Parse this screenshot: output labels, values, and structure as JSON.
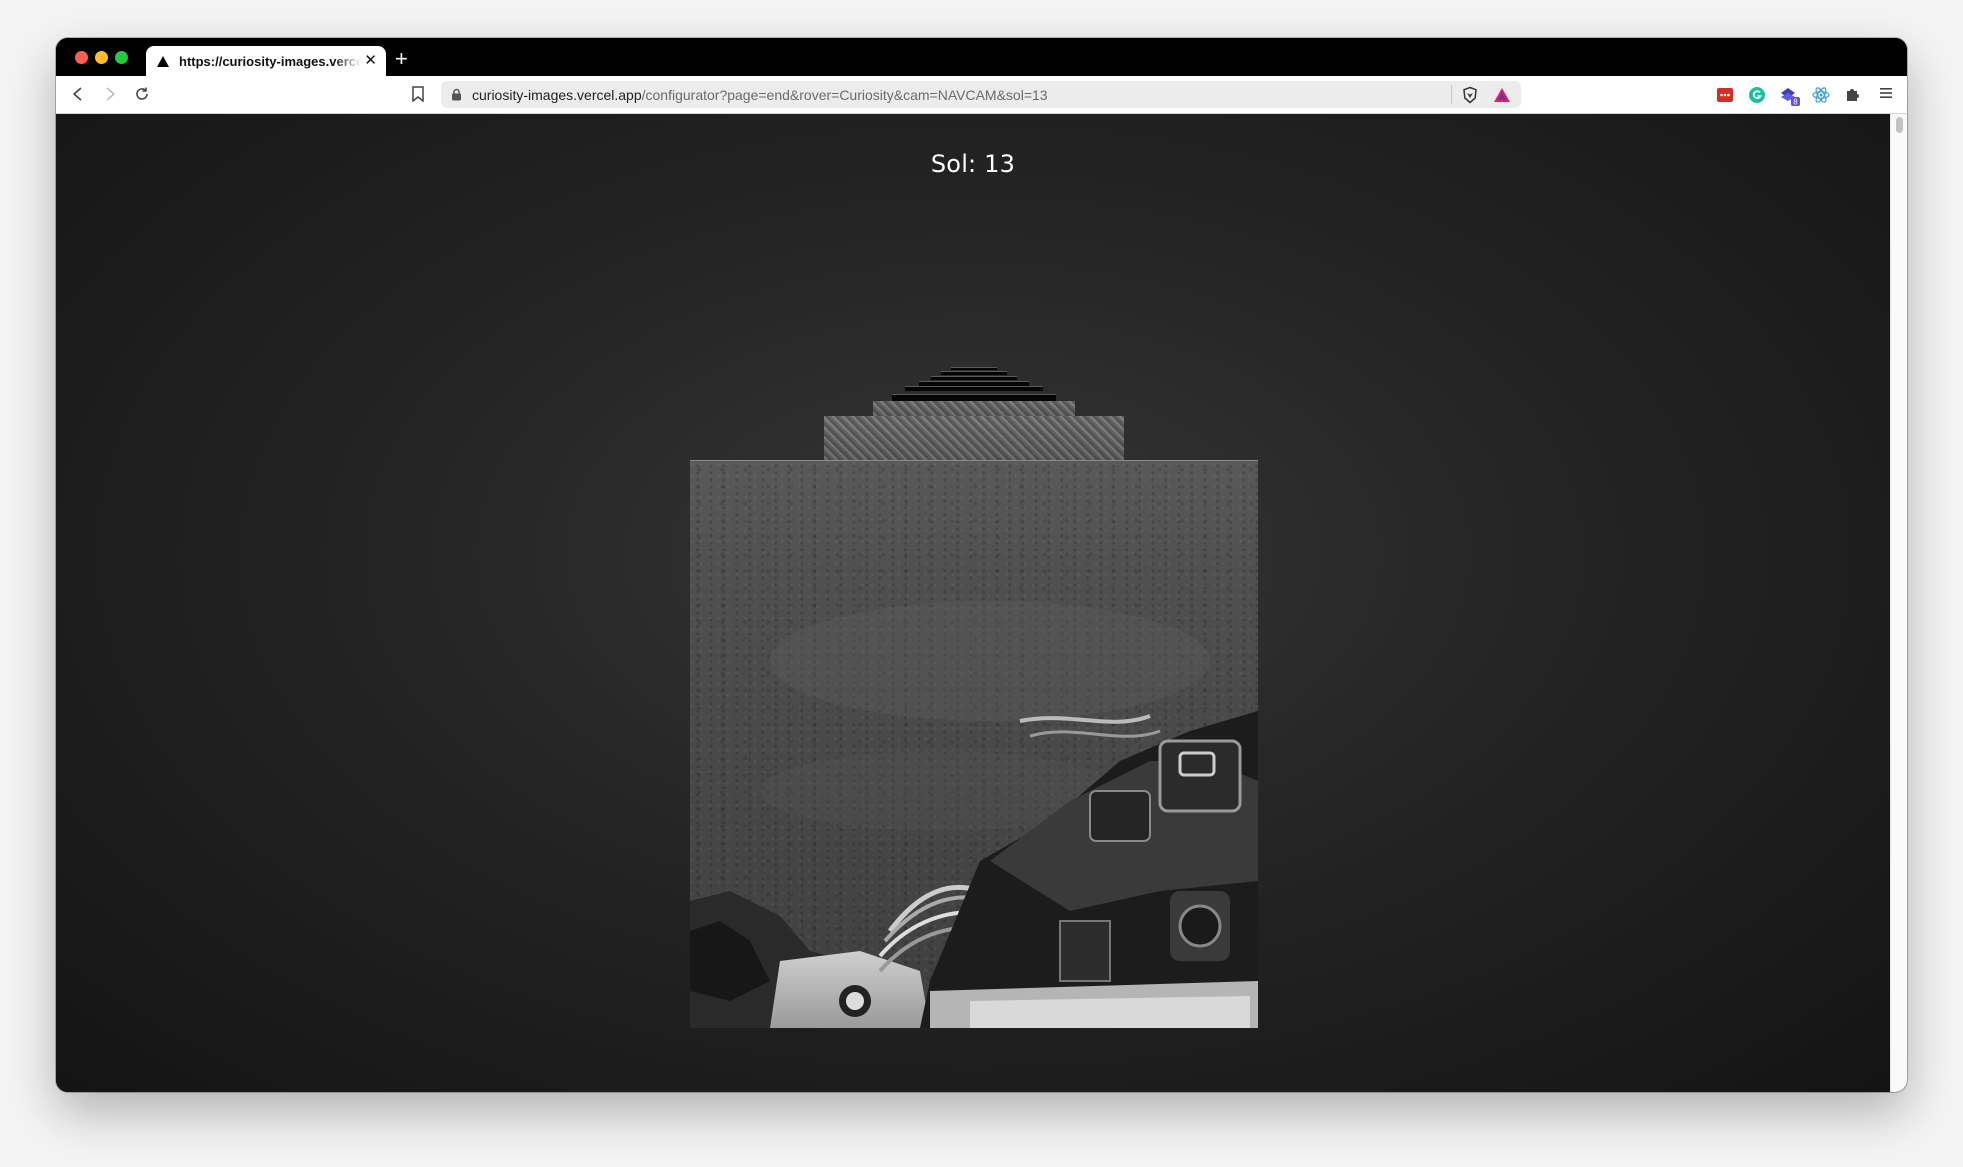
{
  "browser": {
    "tab_title": "https://curiosity-images.vercel.app",
    "new_tab_symbol": "+",
    "close_symbol": "✕",
    "url_host": "curiosity-images.vercel.app",
    "url_path": "/configurator?page=end&rover=Curiosity&cam=NAVCAM&sol=13",
    "extension_badge": "8",
    "icons": [
      "back-icon",
      "forward-icon",
      "reload-icon",
      "bookmark-icon",
      "lock-icon",
      "brave-shield-icon",
      "brave-rewards-icon",
      "lastpass-icon",
      "grammarly-icon",
      "extension-icon",
      "react-devtools-icon",
      "puzzle-icon",
      "menu-icon"
    ]
  },
  "page": {
    "title": "Sol: 13"
  },
  "colors": {
    "background_center": "#363636",
    "background_edge": "#141414",
    "title_text": "#ffffff",
    "tab_bar": "#000000",
    "toolbar": "#ffffff",
    "url_bar": "#ececec"
  }
}
